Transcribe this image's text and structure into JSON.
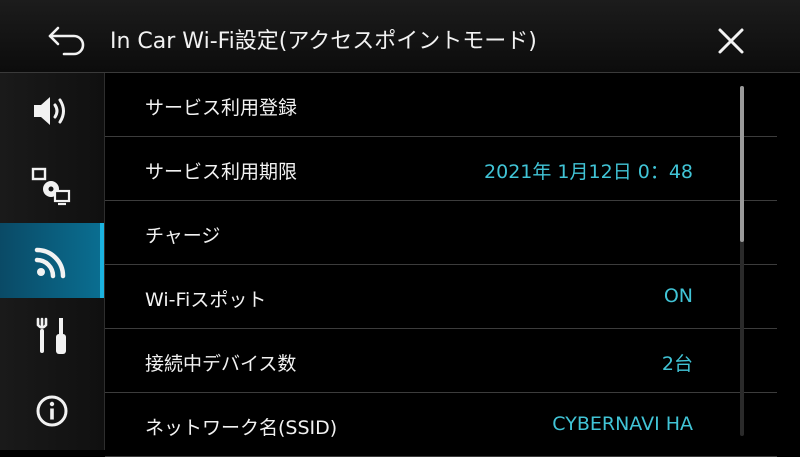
{
  "header": {
    "title": "In Car Wi-Fi設定(アクセスポイントモード)",
    "back_icon": "back-arrow-icon",
    "close_icon": "close-icon"
  },
  "sidebar": {
    "items": [
      {
        "icon": "speaker-volume-icon",
        "active": false
      },
      {
        "icon": "devices-disc-icon",
        "active": false
      },
      {
        "icon": "wifi-signal-icon",
        "active": true
      },
      {
        "icon": "tools-icon",
        "active": false
      },
      {
        "icon": "info-icon",
        "active": false
      }
    ],
    "active_color": "#0a6f92"
  },
  "list": {
    "rows": [
      {
        "label": "サービス利用登録",
        "value": ""
      },
      {
        "label": "サービス利用期限",
        "value": "2021年 1月12日 0：48"
      },
      {
        "label": "チャージ",
        "value": ""
      },
      {
        "label": "Wi-Fiスポット",
        "value": "ON"
      },
      {
        "label": "接続中デバイス数",
        "value": "2台"
      },
      {
        "label": "ネットワーク名(SSID)",
        "value": "CYBERNAVI HA"
      }
    ],
    "value_color": "#41c4d6"
  }
}
